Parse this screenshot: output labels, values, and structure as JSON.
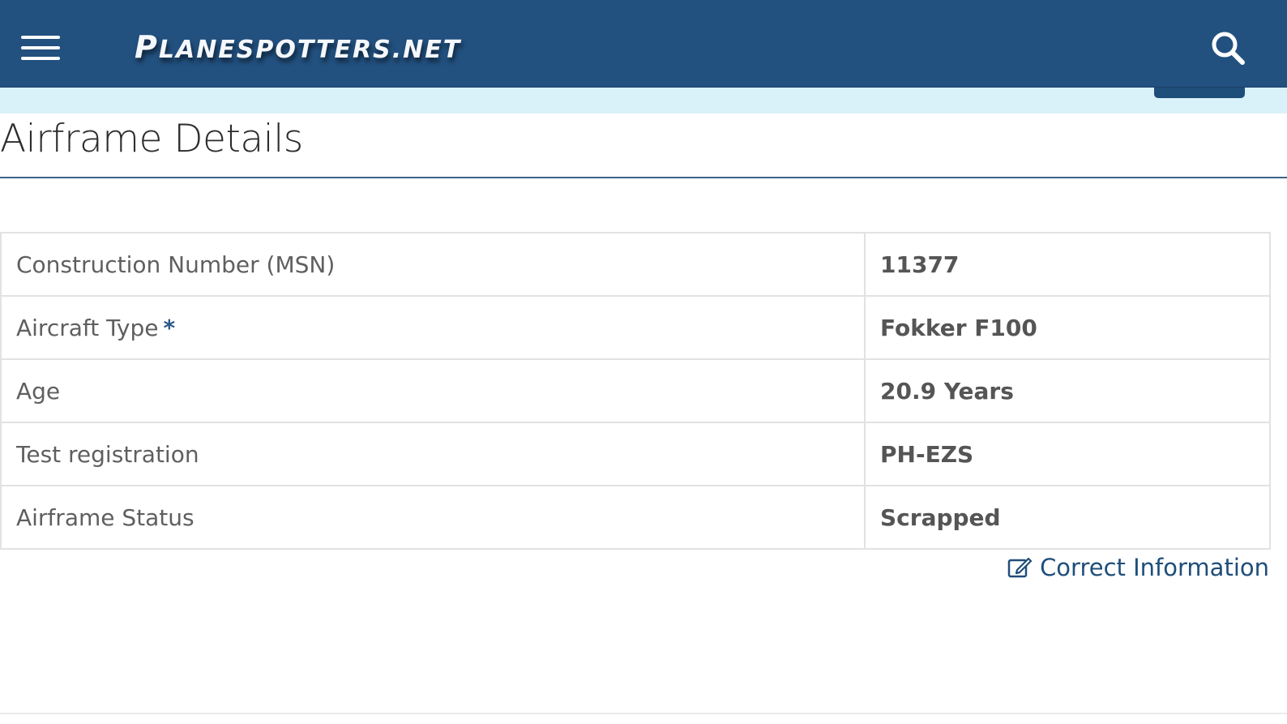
{
  "header": {
    "logo_first": "P",
    "logo_rest": "lanespotters.net",
    "menu_icon": "hamburger-menu-icon",
    "search_icon": "search-icon",
    "colors": {
      "bar": "#22507f",
      "band": "#d9f1f8"
    }
  },
  "main": {
    "title": "Airframe Details",
    "rows": [
      {
        "label": "Construction Number (MSN)",
        "value": "11377"
      },
      {
        "label": "Aircraft Type",
        "marker": "*",
        "value": "Fokker F100"
      },
      {
        "label": "Age",
        "value": "20.9 Years"
      },
      {
        "label": "Test registration",
        "value": "PH-EZS"
      },
      {
        "label": "Airframe Status",
        "value": "Scrapped"
      }
    ],
    "correct_link": {
      "label": "Correct Information",
      "icon": "edit-icon"
    }
  }
}
